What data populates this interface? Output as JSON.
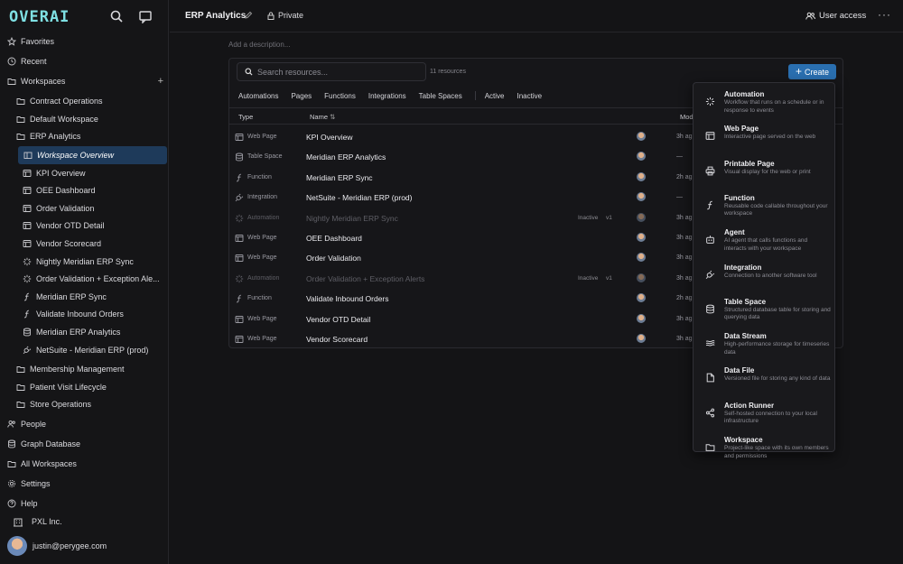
{
  "brand": {
    "logo_text": "OVERAI",
    "accent": "#7fe0e3"
  },
  "sidebar": {
    "top_items": [
      {
        "label": "Favorites",
        "icon": "star-icon"
      },
      {
        "label": "Recent",
        "icon": "clock-icon"
      },
      {
        "label": "Workspaces",
        "icon": "folder-icon"
      }
    ],
    "workspaces": [
      {
        "label": "Contract Operations"
      },
      {
        "label": "Default Workspace"
      },
      {
        "label": "ERP Analytics"
      }
    ],
    "erp_children": [
      {
        "label": "Workspace Overview",
        "icon": "overview-icon",
        "active": true
      },
      {
        "label": "KPI Overview",
        "icon": "page-icon"
      },
      {
        "label": "OEE Dashboard",
        "icon": "page-icon"
      },
      {
        "label": "Order Validation",
        "icon": "page-icon"
      },
      {
        "label": "Vendor OTD Detail",
        "icon": "page-icon"
      },
      {
        "label": "Vendor Scorecard",
        "icon": "page-icon"
      },
      {
        "label": "Nightly Meridian ERP Sync",
        "icon": "automation-icon"
      },
      {
        "label": "Order Validation + Exception Ale...",
        "icon": "automation-icon"
      },
      {
        "label": "Meridian ERP Sync",
        "icon": "function-icon"
      },
      {
        "label": "Validate Inbound Orders",
        "icon": "function-icon"
      },
      {
        "label": "Meridian ERP Analytics",
        "icon": "database-icon"
      },
      {
        "label": "NetSuite - Meridian ERP (prod)",
        "icon": "plug-icon"
      }
    ],
    "more_workspaces": [
      {
        "label": "Membership Management"
      },
      {
        "label": "Patient Visit Lifecycle"
      },
      {
        "label": "Store Operations"
      }
    ],
    "bottom_items": [
      {
        "label": "People",
        "icon": "people-icon"
      },
      {
        "label": "Graph Database",
        "icon": "database-icon"
      },
      {
        "label": "All Workspaces",
        "icon": "folder-icon"
      },
      {
        "label": "Settings",
        "icon": "gear-icon"
      },
      {
        "label": "Help",
        "icon": "help-icon"
      }
    ],
    "org": "PXL Inc.",
    "user_email": "justin@perygee.com"
  },
  "header": {
    "title": "ERP Analytics",
    "visibility": "Private",
    "user_access": "User access"
  },
  "description_placeholder": "Add a description...",
  "resources": {
    "search_placeholder": "Search resources...",
    "count": "11 resources",
    "create_label": "Create",
    "filters": [
      "Automations",
      "Pages",
      "Functions",
      "Integrations",
      "Table Spaces"
    ],
    "status_filters": [
      "Active",
      "Inactive"
    ],
    "columns": {
      "type": "Type",
      "name": "Name",
      "modified": "Mod"
    },
    "rows": [
      {
        "type": "Web Page",
        "icon": "page-icon",
        "name": "KPI Overview",
        "modified": "3h ag",
        "inactive": false
      },
      {
        "type": "Table Space",
        "icon": "database-icon",
        "name": "Meridian ERP Analytics",
        "modified": "—",
        "inactive": false
      },
      {
        "type": "Function",
        "icon": "function-icon",
        "name": "Meridian ERP Sync",
        "modified": "2h ag",
        "inactive": false
      },
      {
        "type": "Integration",
        "icon": "plug-icon",
        "name": "NetSuite - Meridian ERP (prod)",
        "modified": "—",
        "inactive": false
      },
      {
        "type": "Automation",
        "icon": "automation-icon",
        "name": "Nightly Meridian ERP Sync",
        "modified": "3h ag",
        "inactive": true,
        "status": "Inactive",
        "version": "v1"
      },
      {
        "type": "Web Page",
        "icon": "page-icon",
        "name": "OEE Dashboard",
        "modified": "3h ag",
        "inactive": false
      },
      {
        "type": "Web Page",
        "icon": "page-icon",
        "name": "Order Validation",
        "modified": "3h ag",
        "inactive": false
      },
      {
        "type": "Automation",
        "icon": "automation-icon",
        "name": "Order Validation + Exception Alerts",
        "modified": "3h ag",
        "inactive": true,
        "status": "Inactive",
        "version": "v1"
      },
      {
        "type": "Function",
        "icon": "function-icon",
        "name": "Validate Inbound Orders",
        "modified": "2h ag",
        "inactive": false
      },
      {
        "type": "Web Page",
        "icon": "page-icon",
        "name": "Vendor OTD Detail",
        "modified": "3h ag",
        "inactive": false
      },
      {
        "type": "Web Page",
        "icon": "page-icon",
        "name": "Vendor Scorecard",
        "modified": "3h ag",
        "inactive": false
      }
    ]
  },
  "create_menu": [
    {
      "title": "Automation",
      "desc": "Workflow that runs on a schedule or in response to events",
      "icon": "automation-icon"
    },
    {
      "title": "Web Page",
      "desc": "Interactive page served on the web",
      "icon": "page-icon"
    },
    {
      "title": "Printable Page",
      "desc": "Visual display for the web or print",
      "icon": "printer-icon"
    },
    {
      "title": "Function",
      "desc": "Reusable code callable throughout your workspace",
      "icon": "function-icon"
    },
    {
      "title": "Agent",
      "desc": "AI agent that calls functions and interacts with your workspace",
      "icon": "robot-icon"
    },
    {
      "title": "Integration",
      "desc": "Connection to another software tool",
      "icon": "plug-icon"
    },
    {
      "title": "Table Space",
      "desc": "Structured database table for storing and querying data",
      "icon": "database-icon"
    },
    {
      "title": "Data Stream",
      "desc": "High-performance storage for timeseries data",
      "icon": "stream-icon"
    },
    {
      "title": "Data File",
      "desc": "Versioned file for storing any kind of data",
      "icon": "file-icon"
    },
    {
      "title": "Action Runner",
      "desc": "Self-hosted connection to your local infrastructure",
      "icon": "share-icon"
    },
    {
      "title": "Workspace",
      "desc": "Project-like space with its own members and permissions",
      "icon": "folder-icon"
    }
  ]
}
